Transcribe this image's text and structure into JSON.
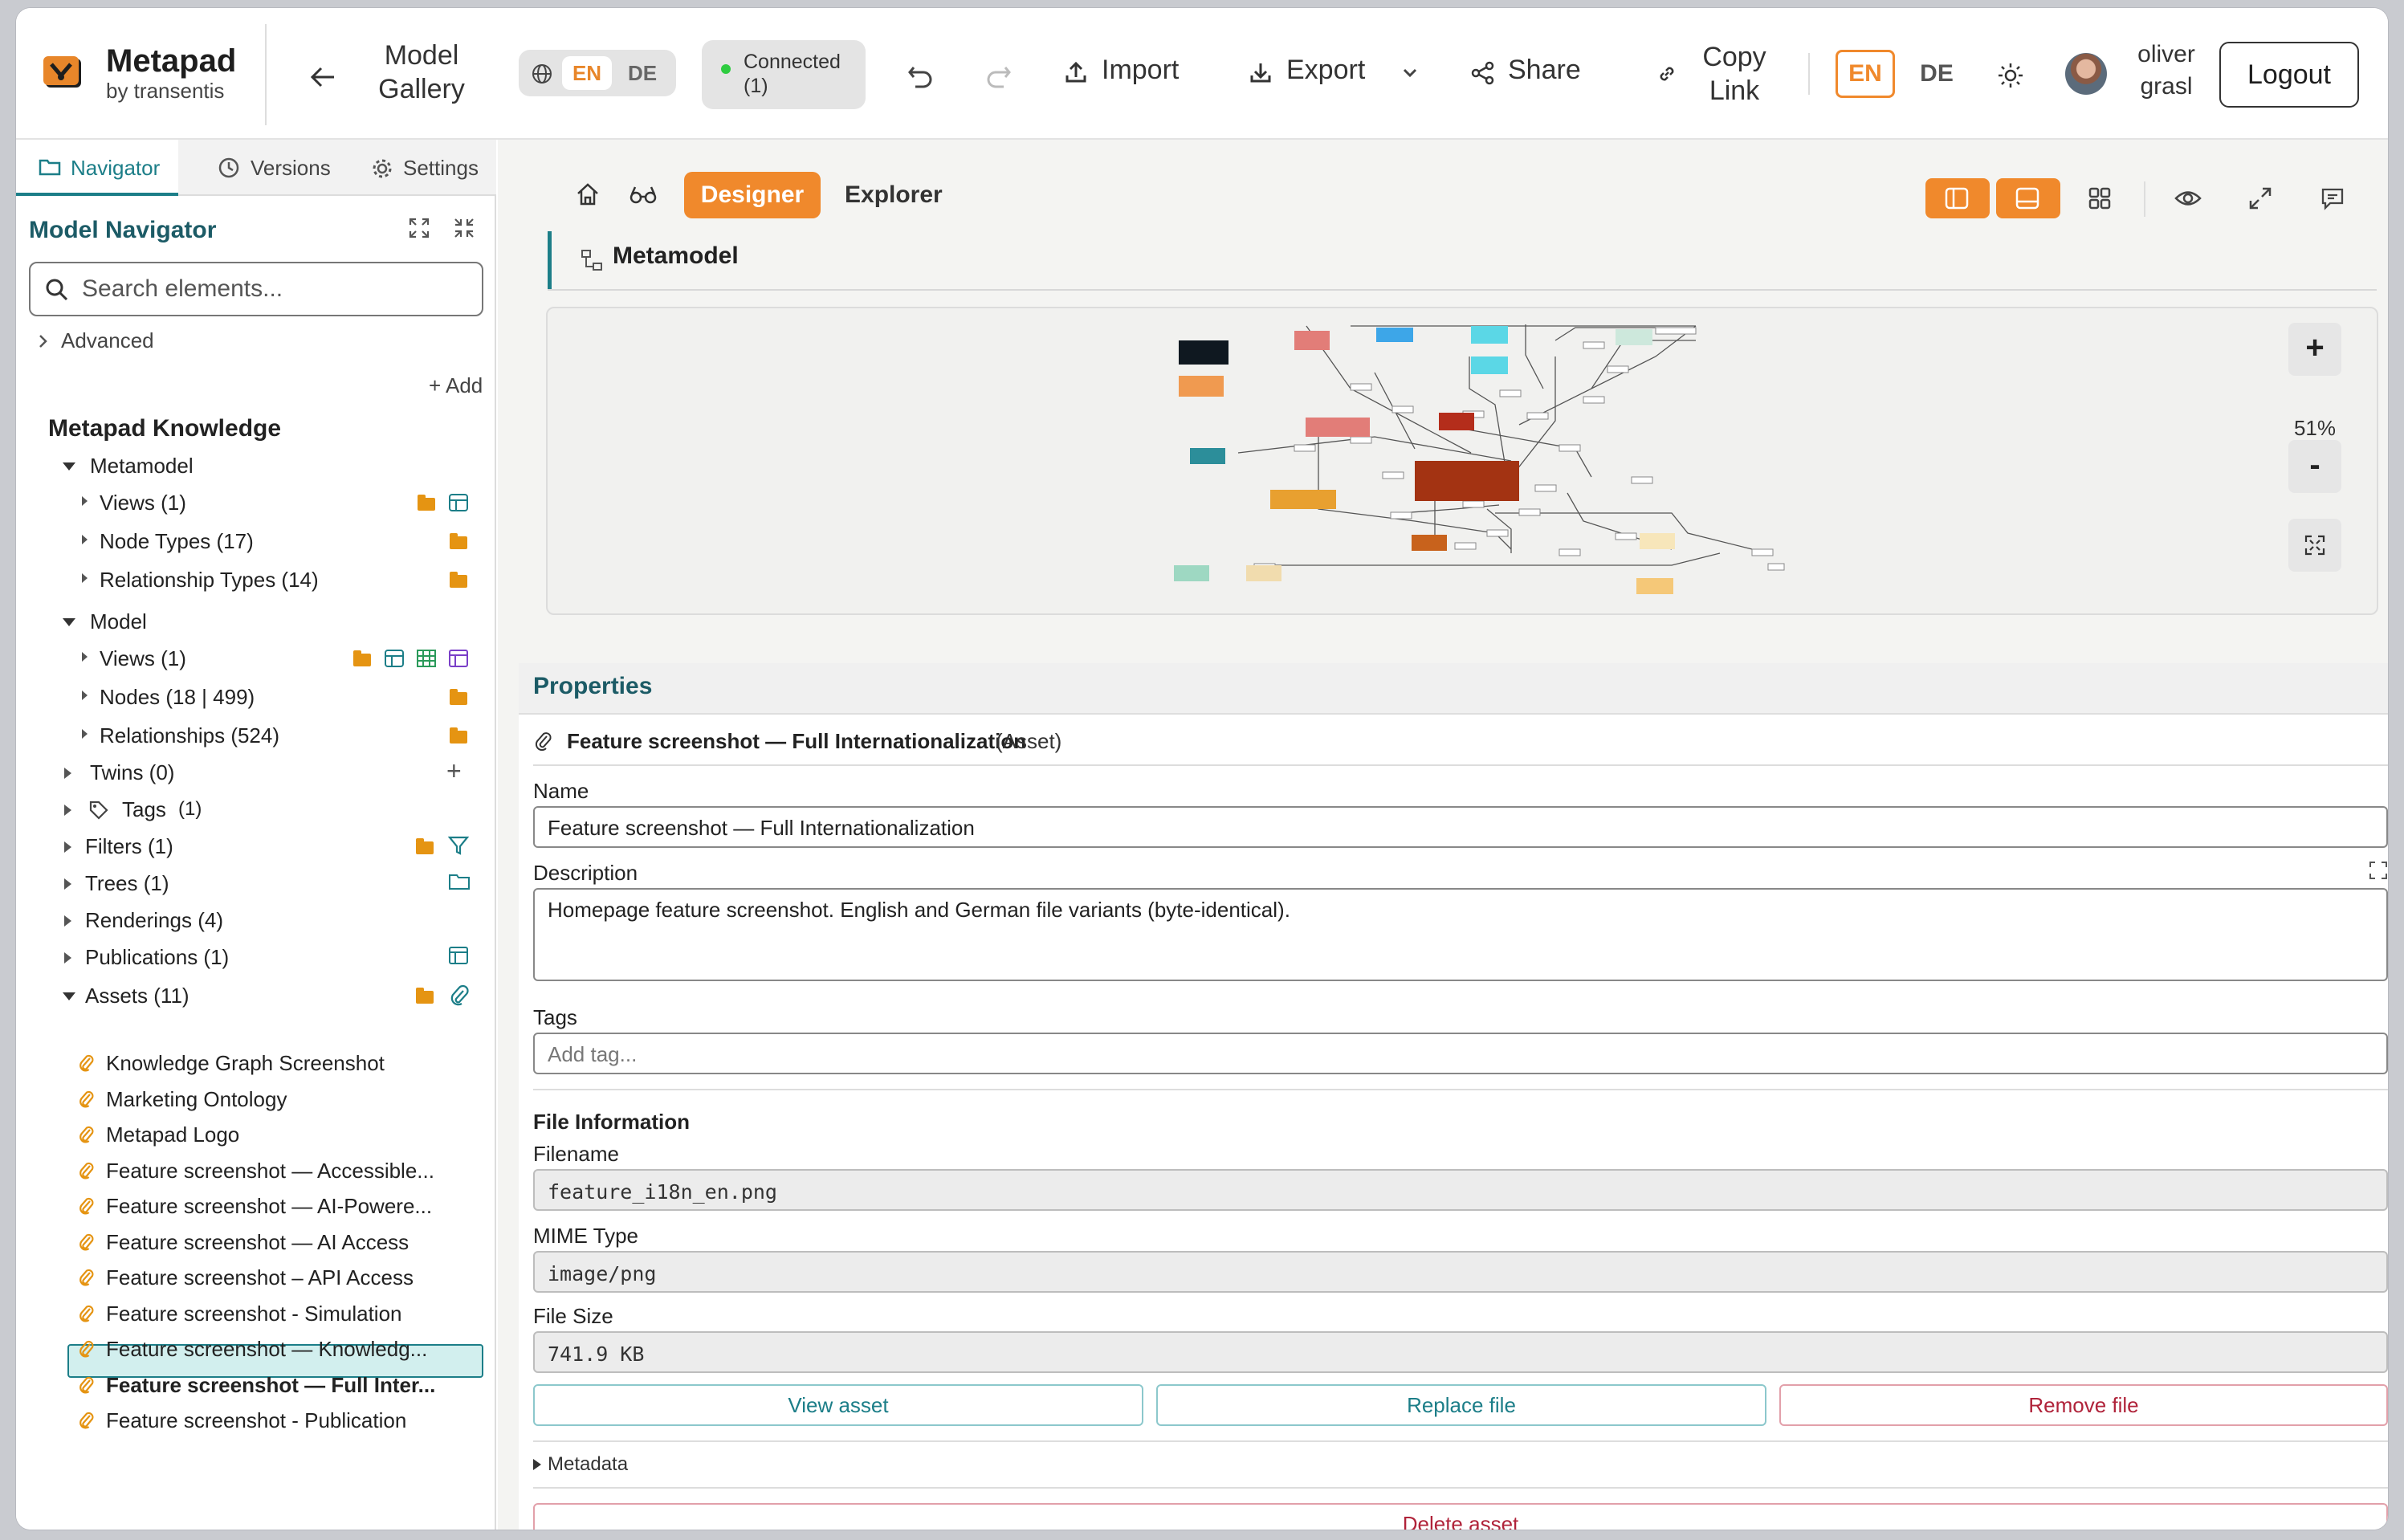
{
  "app": {
    "name": "Metapad",
    "subtitle": "by transentis"
  },
  "topbar": {
    "back_label_1": "Model",
    "back_label_2": "Gallery",
    "lang_left": {
      "active": "EN",
      "inactive": "DE"
    },
    "connection": {
      "line1": "Connected",
      "line2": "(1)",
      "dot_color": "#2ecc40"
    },
    "import_label": "Import",
    "export_label": "Export",
    "share_label": "Share",
    "copy_link_1": "Copy",
    "copy_link_2": "Link",
    "lang_right": {
      "active": "EN",
      "inactive": "DE"
    },
    "user_1": "oliver",
    "user_2": "grasl",
    "logout_label": "Logout"
  },
  "sidebar": {
    "tabs": {
      "navigator": "Navigator",
      "versions": "Versions",
      "settings": "Settings"
    },
    "title": "Model Navigator",
    "search_placeholder": "Search elements...",
    "advanced": "Advanced",
    "add": "+ Add",
    "root": "Metapad Knowledge",
    "tree": {
      "metamodel": "Metamodel",
      "mm_views": "Views (1)",
      "mm_node_types": "Node Types (17)",
      "mm_rel_types": "Relationship Types (14)",
      "model": "Model",
      "m_views": "Views (1)",
      "m_nodes": "Nodes (18 | 499)",
      "m_rels": "Relationships (524)",
      "twins": "Twins (0)",
      "tags": "Tags",
      "tags_count": "(1)",
      "filters": "Filters (1)",
      "trees": "Trees (1)",
      "renderings": "Renderings (4)",
      "publications": "Publications (1)",
      "assets": "Assets (11)"
    },
    "assets": [
      "Knowledge Graph Screenshot",
      "Marketing Ontology",
      "Metapad Logo",
      "Feature screenshot — Accessible...",
      "Feature screenshot — AI-Powere...",
      "Feature screenshot — AI Access",
      "Feature screenshot – API Access",
      "Feature screenshot - Simulation",
      "Feature screenshot — Knowledg...",
      "Feature screenshot — Full Inter...",
      "Feature screenshot - Publication"
    ]
  },
  "main": {
    "designer": "Designer",
    "explorer": "Explorer",
    "tab": "Metamodel",
    "zoom": "51%",
    "zoom_in": "+",
    "zoom_out": "-"
  },
  "properties": {
    "header": "Properties",
    "asset_title": "Feature screenshot — Full Internationalization",
    "asset_type": "(Asset)",
    "name_label": "Name",
    "name_value": "Feature screenshot — Full Internationalization",
    "description_label": "Description",
    "description_value": "Homepage feature screenshot. English and German file variants (byte-identical).",
    "tags_label": "Tags",
    "tags_placeholder": "Add tag...",
    "file_info": "File Information",
    "filename_label": "Filename",
    "filename_value": "feature_i18n_en.png",
    "mime_label": "MIME Type",
    "mime_value": "image/png",
    "size_label": "File Size",
    "size_value": "741.9 KB",
    "view_asset": "View asset",
    "replace_file": "Replace file",
    "remove_file": "Remove file",
    "metadata": "Metadata",
    "delete_asset": "Delete asset"
  },
  "colors": {
    "accent": "#f0892c",
    "teal": "#1c7e88",
    "danger": "#b0233a"
  }
}
